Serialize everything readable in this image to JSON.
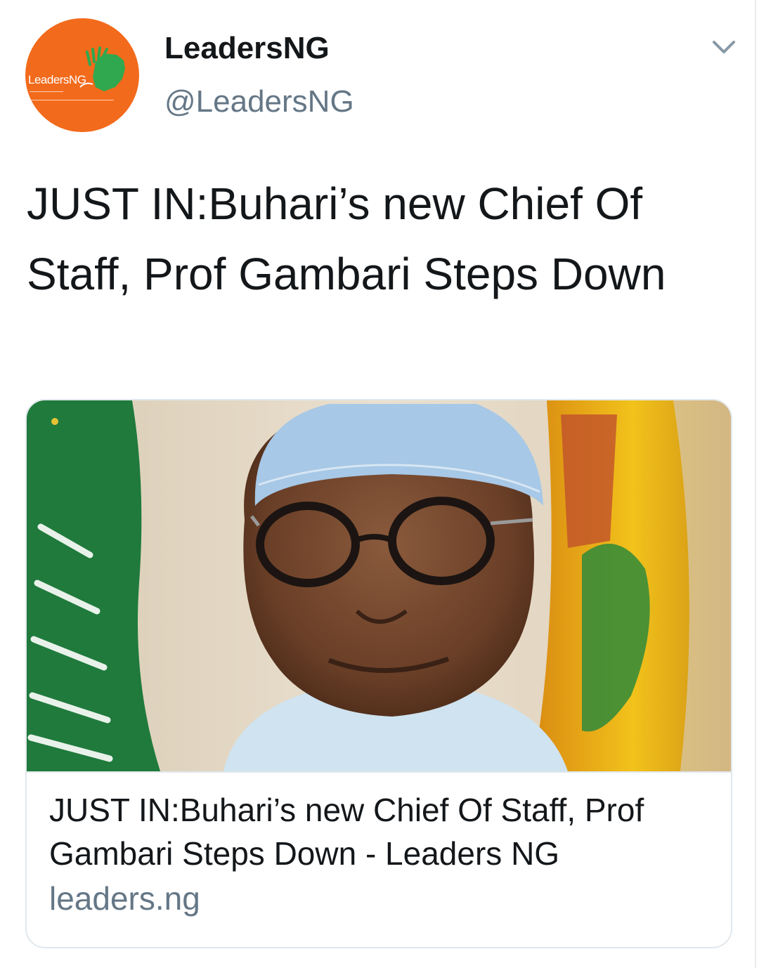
{
  "author": {
    "display_name": "LeadersNG",
    "handle": "@LeadersNG",
    "avatar_brand_text": "LeadersNG",
    "avatar_color": "#f26a1b"
  },
  "tweet": {
    "text": "JUST IN:Buhari’s new Chief Of Staff, Prof Gambari Steps Down"
  },
  "menu_icon": "chevron-down-icon",
  "card": {
    "title": "JUST IN:Buhari’s new Chief Of Staff, Prof Gambari Steps Down - Leaders NG",
    "domain": "leaders.ng"
  },
  "colors": {
    "text_primary": "#14171a",
    "text_secondary": "#657786",
    "border": "#e1e8ed"
  }
}
